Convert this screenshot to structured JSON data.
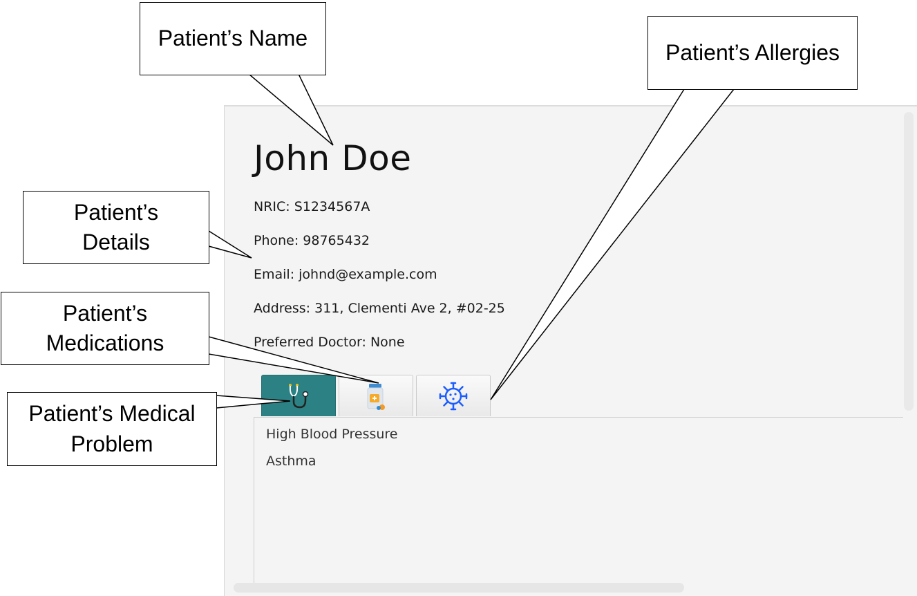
{
  "patient": {
    "name": "John Doe",
    "nric": "NRIC: S1234567A",
    "phone": "Phone: 98765432",
    "email": "Email: johnd@example.com",
    "address": "Address: 311, Clementi Ave 2, #02-25",
    "doctor": "Preferred Doctor: None"
  },
  "tabs": [
    {
      "icon": "stethoscope-icon",
      "active": true
    },
    {
      "icon": "medication-bottle-icon",
      "active": false
    },
    {
      "icon": "virus-icon",
      "active": false
    }
  ],
  "medical_problems": [
    "High Blood Pressure",
    "Asthma"
  ],
  "callouts": {
    "name": "Patient’s Name",
    "allergies": "Patient’s Allergies",
    "details_line1": "Patient’s",
    "details_line2": "Details",
    "medications_line1": "Patient’s",
    "medications_line2": "Medications",
    "problem_line1": "Patient’s Medical",
    "problem_line2": "Problem"
  },
  "colors": {
    "active_tab": "#2b8183",
    "virus_icon": "#1a5cff",
    "panel_bg": "#f4f4f4"
  }
}
